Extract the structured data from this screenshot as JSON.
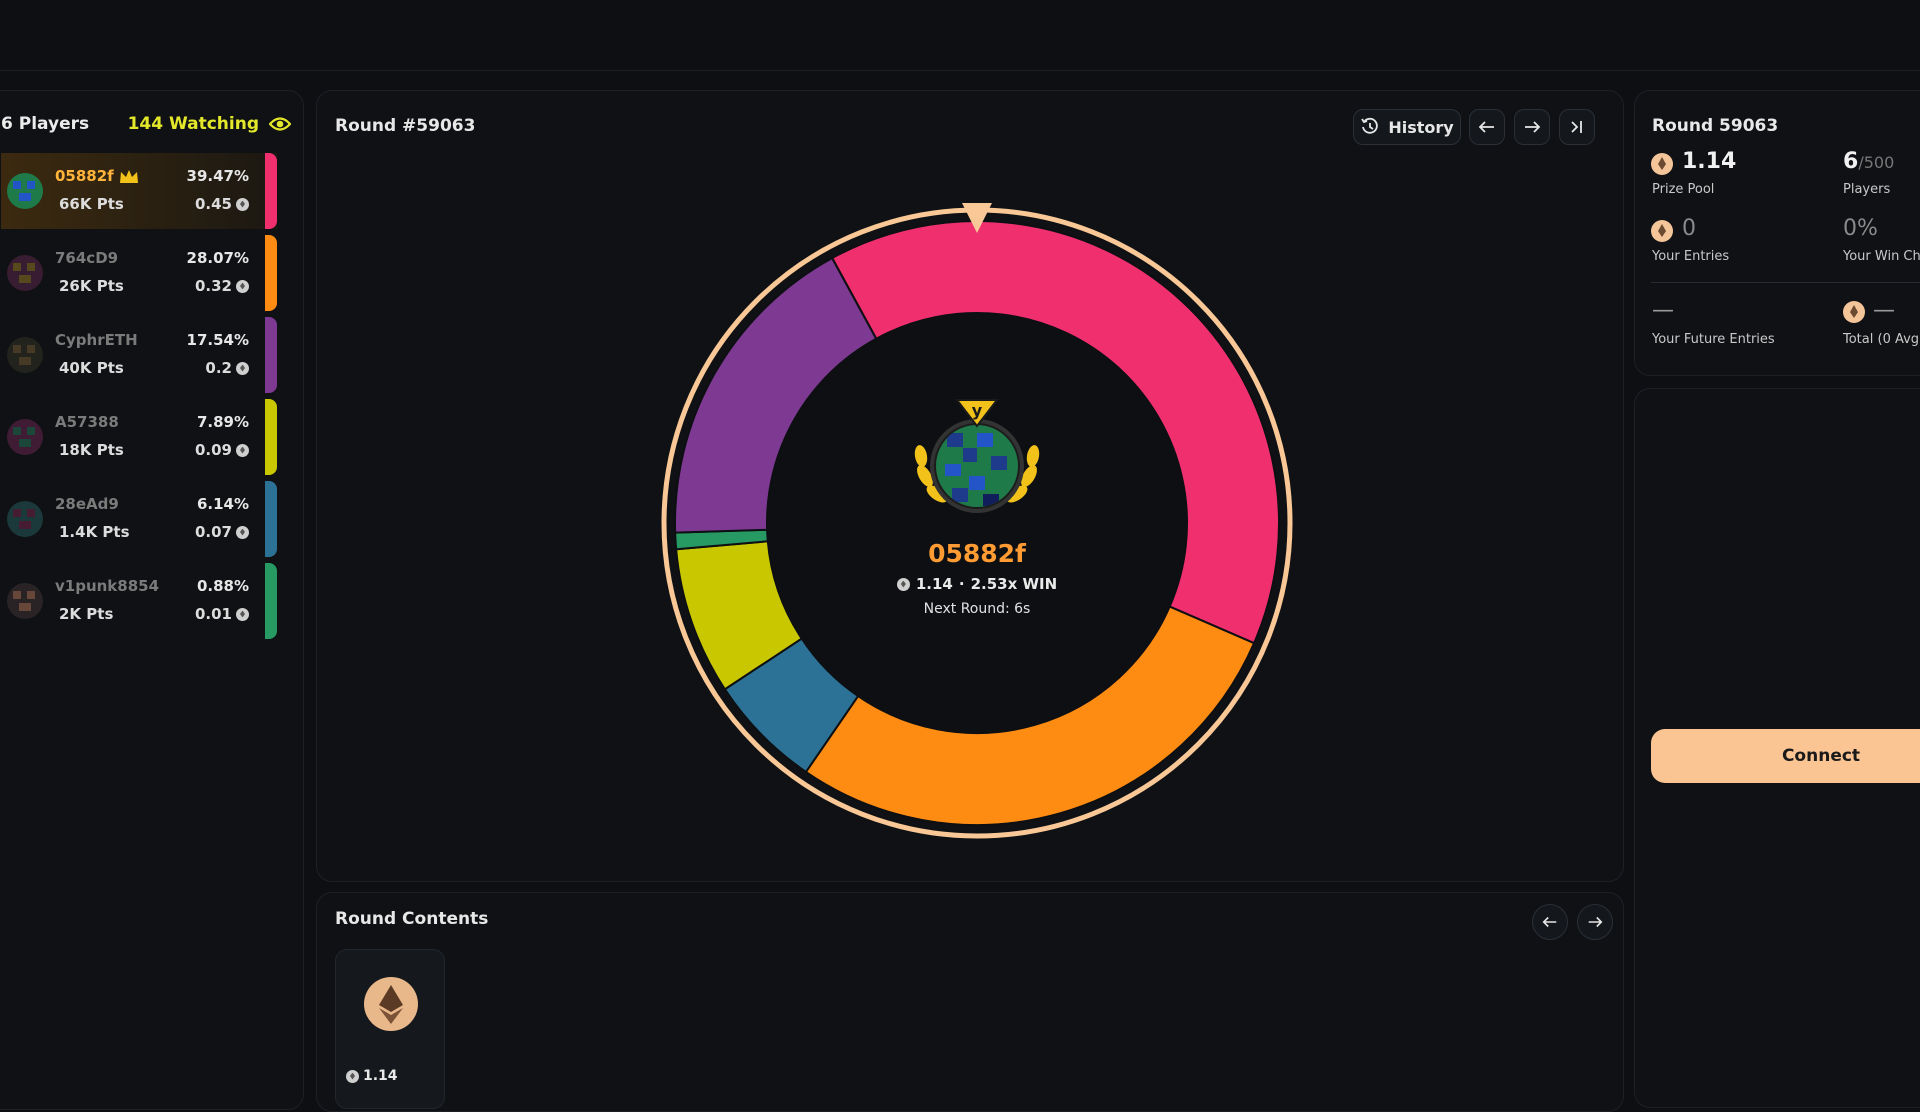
{
  "left_panel": {
    "players_label": "6 Players",
    "watching_label": "144 Watching",
    "players": [
      {
        "name": "05882f",
        "points": "66K Pts",
        "percent": "39.47%",
        "amount": "0.45",
        "color": "#ef2f6e",
        "top": true
      },
      {
        "name": "764cD9",
        "points": "26K Pts",
        "percent": "28.07%",
        "amount": "0.32",
        "color": "#ff8c12"
      },
      {
        "name": "CyphrETH",
        "points": "40K Pts",
        "percent": "17.54%",
        "amount": "0.2",
        "color": "#7e3a92"
      },
      {
        "name": "A57388",
        "points": "18K Pts",
        "percent": "7.89%",
        "amount": "0.09",
        "color": "#c9c800"
      },
      {
        "name": "28eAd9",
        "points": "1.4K Pts",
        "percent": "6.14%",
        "amount": "0.07",
        "color": "#2c7296"
      },
      {
        "name": "v1punk8854",
        "points": "2K Pts",
        "percent": "0.88%",
        "amount": "0.01",
        "color": "#279a63"
      }
    ]
  },
  "round": {
    "title": "Round #59063",
    "history_label": "History",
    "winner_name": "05882f",
    "win_amount": "1.14",
    "win_multiplier": "2.53x WIN",
    "next_round": "Next Round: 6s",
    "medal_letter": "y"
  },
  "wheel": {
    "segments": [
      {
        "player": "05882f",
        "share": 0.3947,
        "color": "#ef2f6e"
      },
      {
        "player": "764cD9",
        "share": 0.2807,
        "color": "#ff8c12"
      },
      {
        "player": "28eAd9",
        "share": 0.0614,
        "color": "#2c7296"
      },
      {
        "player": "A57388",
        "share": 0.0789,
        "color": "#c9c800"
      },
      {
        "player": "v1punk8854",
        "share": 0.0088,
        "color": "#279a63"
      },
      {
        "player": "CyphrETH",
        "share": 0.1754,
        "color": "#7e3a92"
      }
    ],
    "rim_color": "#f9c896"
  },
  "contents": {
    "title": "Round Contents",
    "item_value": "1.14"
  },
  "stats": {
    "round_label": "Round 59063",
    "prize_pool": "1.14",
    "prize_pool_label": "Prize Pool",
    "players_count": "6",
    "players_max": "/500",
    "players_label": "Players",
    "your_entries": "0",
    "your_entries_label": "Your Entries",
    "win_chance": "0%",
    "win_chance_label": "Your Win Ch",
    "future_entries": "—",
    "future_entries_label": "Your Future Entries",
    "total": "—",
    "total_label": "Total (0 Avg"
  },
  "connect_label": "Connect"
}
